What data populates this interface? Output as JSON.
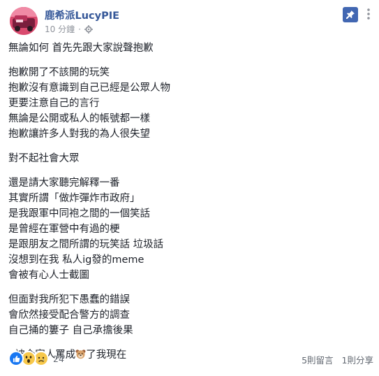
{
  "post": {
    "author": "鹿希派LucyPIE",
    "time": "10 分鐘",
    "dot": "·",
    "paragraphs": [
      [
        "無論如何 首先先跟大家說聲抱歉"
      ],
      [
        "抱歉開了不該開的玩笑",
        "抱歉沒有意識到自己已經是公眾人物",
        "更要注意自己的言行",
        "無論是公開或私人的帳號都一樣",
        "抱歉讓許多人對我的為人很失望"
      ],
      [
        "對不起社會大眾"
      ],
      [
        "還是請大家聽完解釋一番",
        "其實所謂「做炸彈炸市政府」",
        "是我跟軍中同袍之間的一個笑話",
        "是曾經在軍營中有過的梗",
        "是跟朋友之間所謂的玩笑話 垃圾話",
        "沒想到在我 私人ig發的meme",
        "會被有心人士截圖"
      ],
      [
        "但面對我所犯下愚蠢的錯誤",
        "會欣然接受配合警方的調查",
        "自己捅的簍子 自己承擔後果"
      ]
    ],
    "last_line_before": "..被全家人罵成",
    "last_line_after": "了我現在",
    "emoji": "dog-face-icon"
  },
  "footer": {
    "reaction_count": "24",
    "comments": "5則留言",
    "shares": "1則分享"
  },
  "icons": {
    "pin": "pin-icon",
    "more": "more-options-icon",
    "privacy": "gear-icon",
    "reactions": [
      "like-icon",
      "wow-icon",
      "sad-icon"
    ]
  },
  "colors": {
    "author": "#365899",
    "meta": "#90949c",
    "pin_bg": "#4267b2",
    "like": "#1877f2",
    "emoji_yellow": "#f7c84b"
  }
}
